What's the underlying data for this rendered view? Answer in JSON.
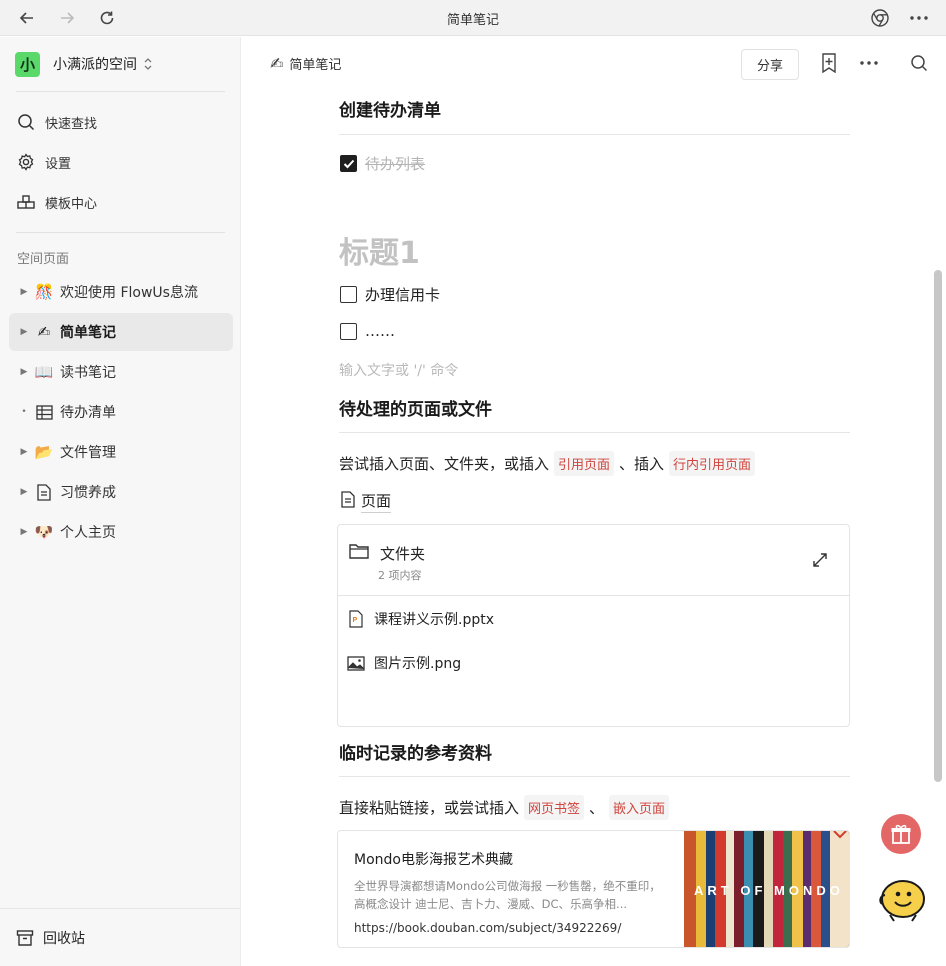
{
  "window": {
    "title": "简单笔记"
  },
  "sidebar": {
    "workspace": {
      "avatar": "小",
      "name": "小满派的空间"
    },
    "nav": [
      {
        "label": "快速查找",
        "icon": "search-icon"
      },
      {
        "label": "设置",
        "icon": "gear-icon"
      },
      {
        "label": "模板中心",
        "icon": "template-icon"
      }
    ],
    "section_label": "空间页面",
    "pages": [
      {
        "label": "欢迎使用 FlowUs息流",
        "icon": "confetti-icon"
      },
      {
        "label": "简单笔记",
        "icon": "writing-hand-icon",
        "active": true
      },
      {
        "label": "读书笔记",
        "icon": "book-icon"
      },
      {
        "label": "待办清单",
        "icon": "table-icon"
      },
      {
        "label": "文件管理",
        "icon": "folder-icon"
      },
      {
        "label": "习惯养成",
        "icon": "document-icon"
      },
      {
        "label": "个人主页",
        "icon": "avatar-icon"
      }
    ],
    "trash_label": "回收站"
  },
  "topbar": {
    "breadcrumb": "简单笔记",
    "share_label": "分享"
  },
  "content": {
    "todo_heading": "创建待办清单",
    "checked_todo": "待办列表",
    "heading1_placeholder": "标题1",
    "todos": [
      "办理信用卡",
      "……"
    ],
    "input_placeholder": "输入文字或 '/' 命令",
    "pending_heading": "待处理的页面或文件",
    "pending_para": {
      "prefix": "尝试插入页面、文件夹，或插入",
      "tag1": "引用页面",
      "middle": "、插入",
      "tag2": "行内引用页面"
    },
    "page_link": "页面",
    "folder": {
      "title": "文件夹",
      "subtitle": "2 项内容",
      "files": [
        {
          "name": "课程讲义示例.pptx",
          "icon": "pptx-file-icon"
        },
        {
          "name": "图片示例.png",
          "icon": "image-file-icon"
        }
      ]
    },
    "ref_heading": "临时记录的参考资料",
    "ref_para": {
      "prefix": "直接粘贴链接，或尝试插入",
      "tag1": "网页书签",
      "middle": "、",
      "tag2": "嵌入页面"
    },
    "bookmark": {
      "title": "Mondo电影海报艺术典藏",
      "desc": "全世界导演都想请Mondo公司做海报 一秒售罄，绝不重印，高概念设计 迪士尼、吉卜力、漫威、DC、乐高争相...",
      "url": "https://book.douban.com/subject/34922269/",
      "cover_text": "ART OF MONDO"
    }
  }
}
